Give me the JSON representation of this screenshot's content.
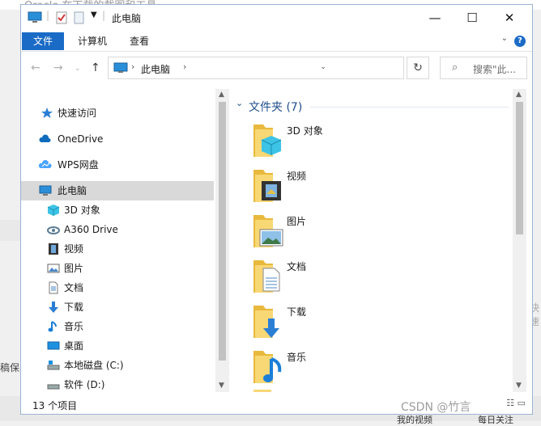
{
  "background": {
    "top_text": "Oracle 在下载的截图和工具",
    "left_text": "稿保",
    "right_text": "快速",
    "bottom_buttons": [
      "我的视频",
      "每日关注"
    ]
  },
  "window": {
    "title": "此电脑",
    "ribbon_tabs": [
      "文件",
      "计算机",
      "查看"
    ],
    "address_path": "此电脑",
    "search_placeholder": "搜索\"此...",
    "sidebar": [
      {
        "label": "快速访问",
        "icon": "star-icon"
      },
      {
        "label": "OneDrive",
        "icon": "cloud-icon"
      },
      {
        "label": "WPS网盘",
        "icon": "wps-cloud-icon"
      },
      {
        "label": "此电脑",
        "icon": "computer-icon",
        "selected": true
      },
      {
        "label": "3D 对象",
        "icon": "cube-icon"
      },
      {
        "label": "A360 Drive",
        "icon": "a360-icon"
      },
      {
        "label": "视频",
        "icon": "video-icon"
      },
      {
        "label": "图片",
        "icon": "picture-icon"
      },
      {
        "label": "文档",
        "icon": "document-icon"
      },
      {
        "label": "下载",
        "icon": "download-icon"
      },
      {
        "label": "音乐",
        "icon": "music-icon"
      },
      {
        "label": "桌面",
        "icon": "desktop-icon"
      },
      {
        "label": "本地磁盘 (C:)",
        "icon": "disk-c-icon"
      },
      {
        "label": "软件 (D:)",
        "icon": "disk-d-icon"
      }
    ],
    "group_header": "文件夹 (7)",
    "folders": [
      {
        "label": "3D 对象",
        "icon": "cube-folder-icon"
      },
      {
        "label": "视频",
        "icon": "video-folder-icon"
      },
      {
        "label": "图片",
        "icon": "picture-folder-icon"
      },
      {
        "label": "文档",
        "icon": "document-folder-icon"
      },
      {
        "label": "下载",
        "icon": "download-folder-icon"
      },
      {
        "label": "音乐",
        "icon": "music-folder-icon"
      }
    ],
    "status": "13 个项目"
  },
  "watermark": "CSDN @竹言"
}
